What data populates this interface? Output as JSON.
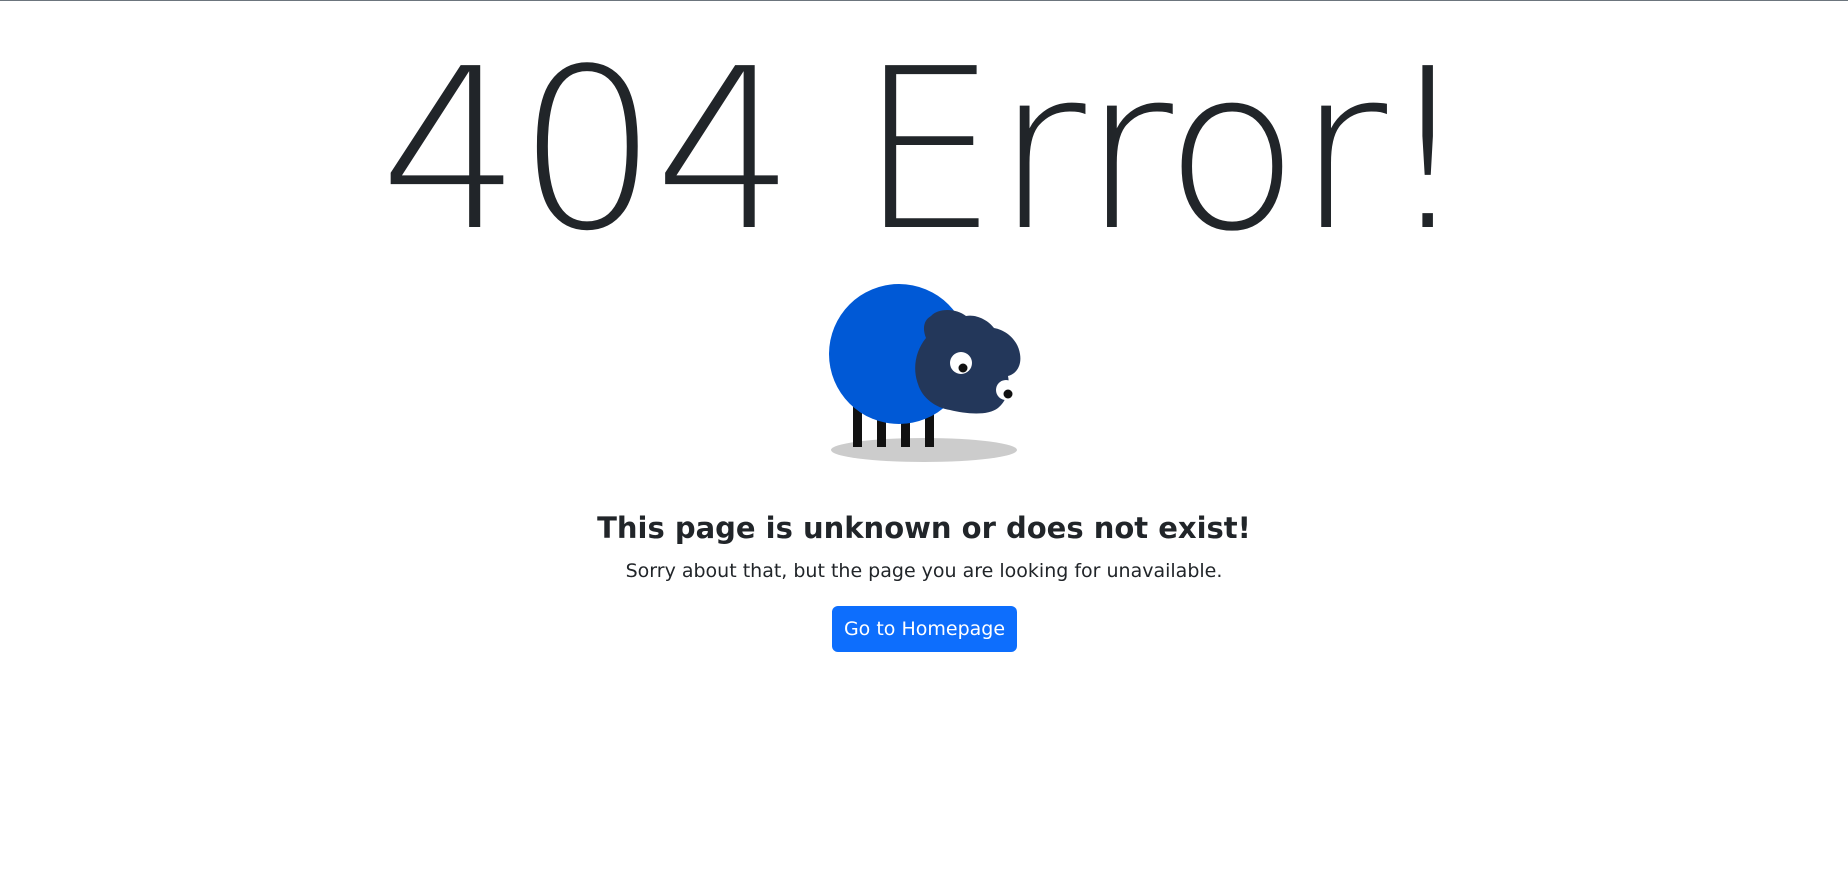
{
  "error": {
    "title": "404 Error!"
  },
  "illustration": {
    "icon": "sheep-icon",
    "body_color": "#0059d6",
    "head_color": "#23375a",
    "leg_color": "#111111",
    "shadow_color": "#cccccc"
  },
  "message": {
    "heading": "This page is unknown or does not exist!",
    "subtext": "Sorry about that, but the page you are looking for unavailable."
  },
  "actions": {
    "home_button_label": "Go to Homepage",
    "accent_color": "#0d6efd"
  }
}
